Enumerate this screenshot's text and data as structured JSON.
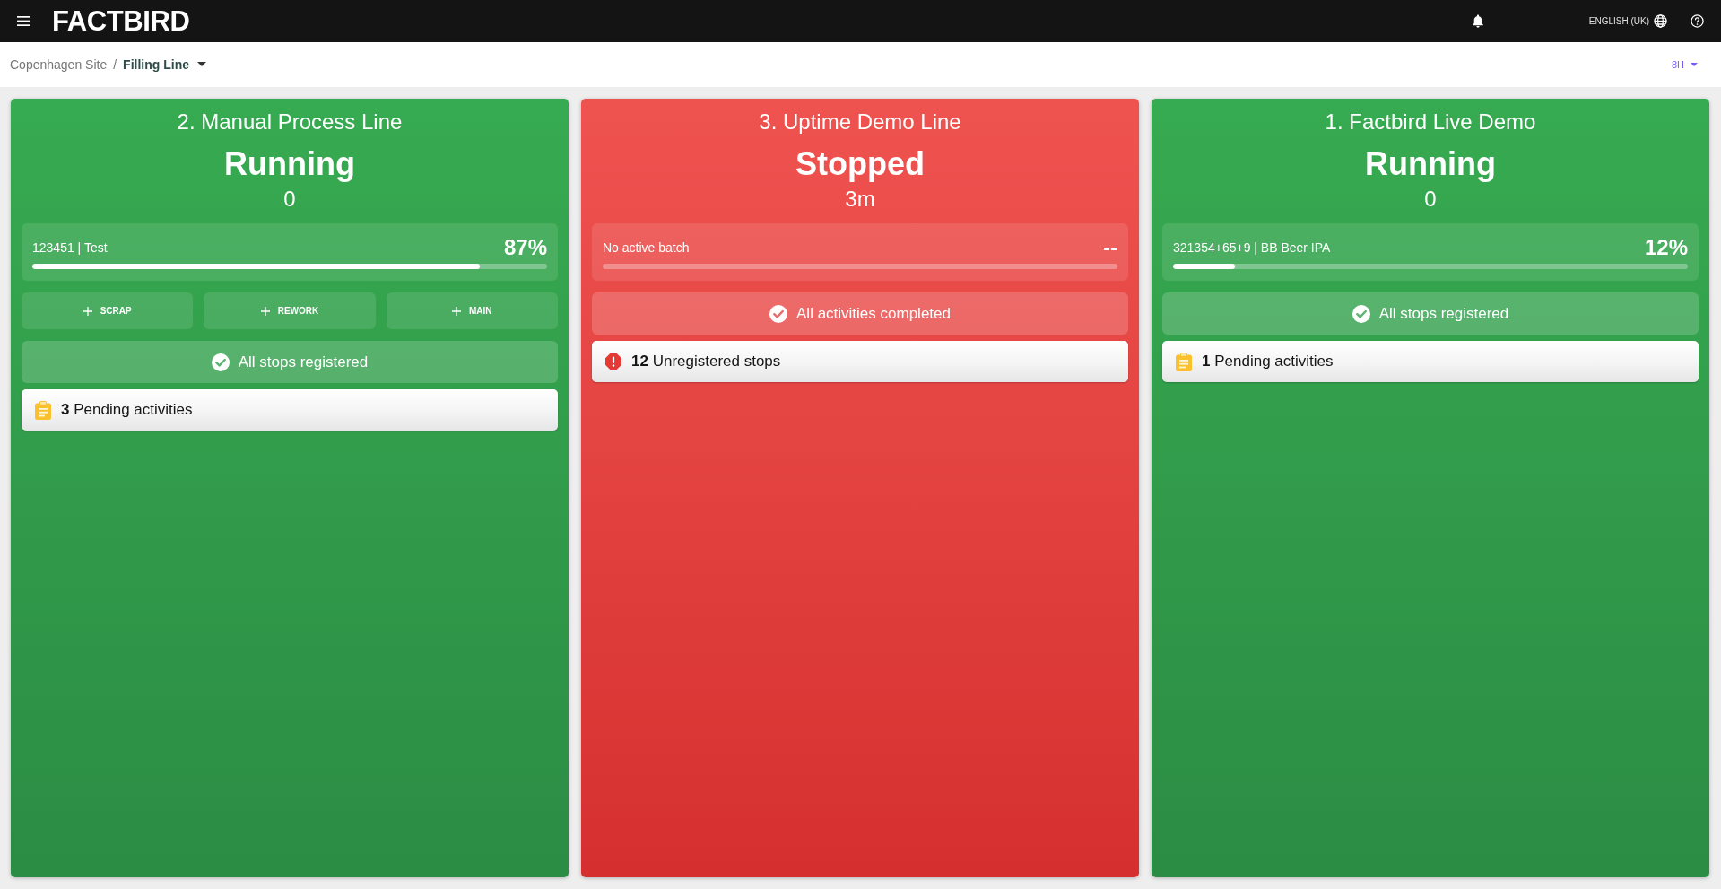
{
  "top_bar": {
    "logo": "FACTBIRD",
    "language": "ENGLISH (UK)"
  },
  "breadcrumb": {
    "items": [
      {
        "label": "Copenhagen Site",
        "selected": false
      },
      {
        "label": "Filling Line",
        "selected": true
      }
    ],
    "separator": "/"
  },
  "time_range": "8H",
  "lines": [
    {
      "title": "2. Manual Process Line",
      "status": {
        "kind": "running",
        "label": "Running"
      },
      "duration": "0",
      "batch": {
        "label": "123451 | Test",
        "percent": "87%",
        "level": 0.87
      },
      "actions": [
        "SCRAP",
        "REWORK",
        "MAIN"
      ],
      "summary": "All stops registered",
      "alert": {
        "kind": "pending",
        "text": "**3** Pending activities"
      }
    },
    {
      "title": "3. Uptime Demo Line",
      "status": {
        "kind": "stopped",
        "label": "Stopped"
      },
      "duration": "3m",
      "batch": {
        "label": "No active batch",
        "percent": "--"
      },
      "summary": "All activities completed",
      "alert": {
        "kind": "unregistered",
        "text": "**12** Unregistered stops"
      }
    },
    {
      "title": "1. Factbird Live Demo",
      "status": {
        "kind": "running",
        "label": "Running"
      },
      "duration": "0",
      "batch": {
        "label": "321354+65+9 | BB Beer IPA",
        "percent": "12%",
        "level": 0.12
      },
      "summary": "All stops registered",
      "alert": {
        "kind": "pending",
        "text": "**1** Pending activities"
      }
    }
  ]
}
